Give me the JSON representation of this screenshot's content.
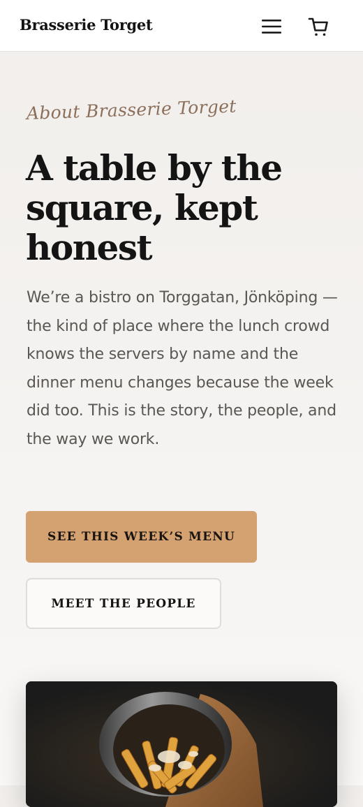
{
  "header": {
    "brand": "Brasserie Torget",
    "menu_icon": "hamburger-menu-icon",
    "cart_icon": "shopping-cart-icon"
  },
  "hero": {
    "eyebrow": "About Brasserie Torget",
    "headline": "A table by the square, kept honest",
    "intro": "We’re a bistro on Torggatan, Jönköping — the kind of place where the lunch crowd knows the servers by name and the dinner menu changes because the week did too. This is the story, the people, and the way we work.",
    "primary_cta": "SEE THIS WEEK’S MENU",
    "secondary_cta": "MEET THE PEOPLE"
  },
  "colors": {
    "accent": "#d4a171",
    "eyebrow": "#8c6f5b",
    "body_text": "#5a5652",
    "photo_background": "#1b1b1b"
  }
}
